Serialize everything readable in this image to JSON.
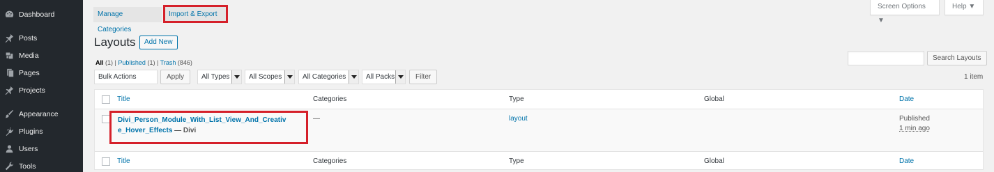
{
  "sidebar": {
    "items": [
      {
        "label": "Dashboard",
        "icon": "dashboard-icon"
      },
      {
        "label": "Posts",
        "icon": "pin-icon"
      },
      {
        "label": "Media",
        "icon": "media-icon"
      },
      {
        "label": "Pages",
        "icon": "pages-icon"
      },
      {
        "label": "Projects",
        "icon": "pin-icon"
      },
      {
        "label": "Appearance",
        "icon": "brush-icon"
      },
      {
        "label": "Plugins",
        "icon": "plugin-icon"
      },
      {
        "label": "Users",
        "icon": "users-icon"
      },
      {
        "label": "Tools",
        "icon": "wrench-icon"
      }
    ]
  },
  "tabs": {
    "manage": "Manage Categories",
    "import_export": "Import & Export"
  },
  "header": {
    "screen_options": "Screen Options ▼",
    "help": "Help ▼",
    "title": "Layouts",
    "add_new": "Add New"
  },
  "views": {
    "all": "All",
    "all_count": "(1)",
    "sep": "|",
    "published": "Published",
    "published_count": "(1)",
    "trash": "Trash",
    "trash_count": "(846)"
  },
  "search": {
    "value": "",
    "button": "Search Layouts"
  },
  "filters": {
    "bulk": "Bulk Actions",
    "apply": "Apply",
    "types": "All Types",
    "scopes": "All Scopes",
    "categories": "All Categories",
    "packs": "All Packs",
    "filter": "Filter",
    "item_count": "1 item"
  },
  "table": {
    "columns": {
      "title": "Title",
      "categories": "Categories",
      "type": "Type",
      "global": "Global",
      "date": "Date"
    },
    "rows": [
      {
        "title": "Divi_Person_Module_With_List_View_And_Creative_Hover_Effects",
        "suffix": " — Divi",
        "categories": "—",
        "type": "layout",
        "global": "",
        "date_status": "Published",
        "date_ago": "1 min ago"
      }
    ]
  },
  "colors": {
    "sidebar_bg": "#23282d",
    "link": "#0073aa",
    "highlight": "#d5202a"
  }
}
